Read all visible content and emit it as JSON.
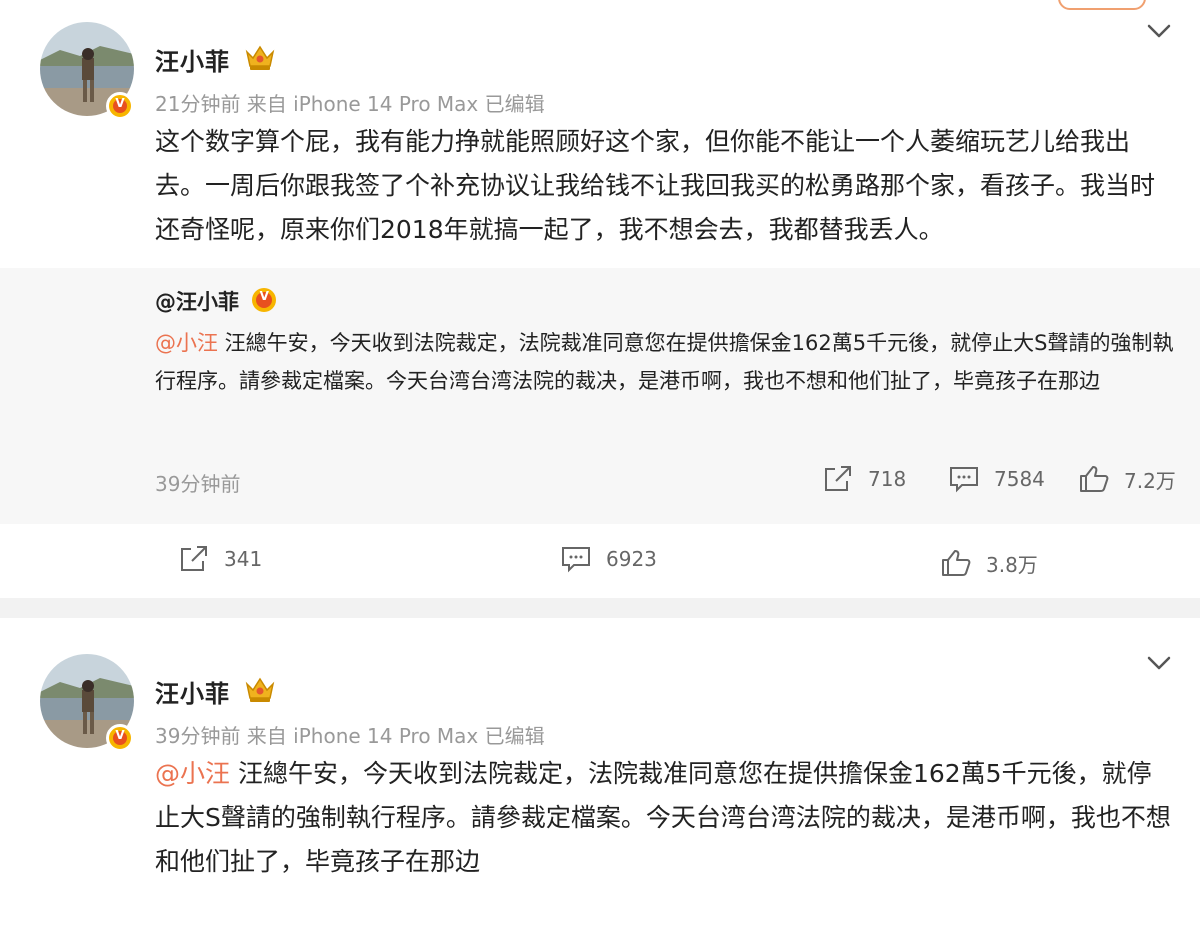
{
  "posts": [
    {
      "username": "汪小菲",
      "meta": "21分钟前  来自 iPhone 14 Pro Max 已编辑",
      "text": "这个数字算个屁，我有能力挣就能照顾好这个家，但你能不能让一个人萎缩玩艺儿给我出去。一周后你跟我签了个补充协议让我给钱不让我回我买的松勇路那个家，看孩子。我当时还奇怪呢，原来你们2018年就搞一起了，我不想会去，我都替我丢人。",
      "repost": {
        "user": "@汪小菲",
        "mention": "@小汪",
        "text": " 汪總午安，今天收到法院裁定，法院裁准同意您在提供擔保金162萬5千元後，就停止大S聲請的強制執行程序。請參裁定檔案。今天台湾台湾法院的裁决，是港币啊，我也不想和他们扯了，毕竟孩子在那边",
        "time": "39分钟前",
        "shares": "718",
        "comments": "7584",
        "likes": "7.2万"
      },
      "shares": "341",
      "comments": "6923",
      "likes": "3.8万"
    },
    {
      "username": "汪小菲",
      "meta": "39分钟前  来自 iPhone 14 Pro Max 已编辑",
      "mention": "@小汪",
      "text": " 汪總午安，今天收到法院裁定，法院裁准同意您在提供擔保金162萬5千元後，就停止大S聲請的強制執行程序。請參裁定檔案。今天台湾台湾法院的裁决，是港币啊，我也不想和他们扯了，毕竟孩子在那边"
    }
  ],
  "colors": {
    "mention": "#eb7350",
    "badge": "#f7b500",
    "crown": "#e8a200"
  }
}
